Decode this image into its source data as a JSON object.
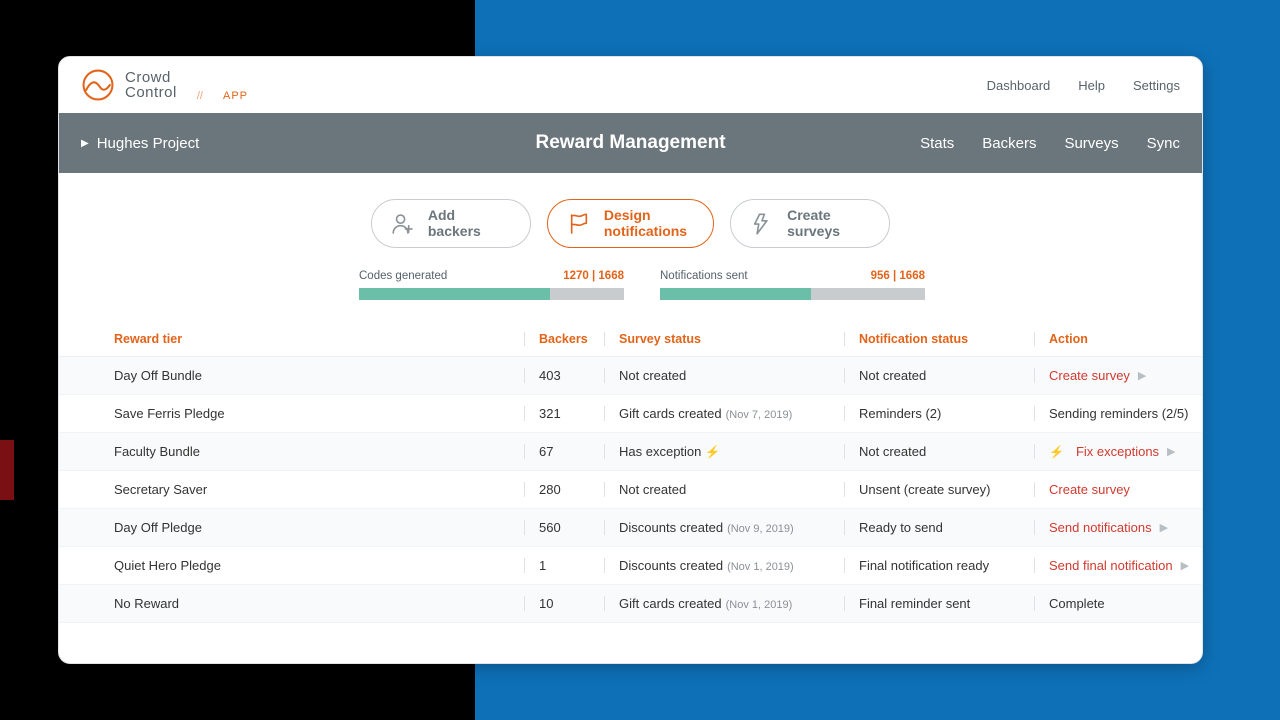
{
  "brand": {
    "line1": "Crowd",
    "line2": "Control",
    "app_tag": "APP"
  },
  "topnav": {
    "dashboard": "Dashboard",
    "help": "Help",
    "settings": "Settings"
  },
  "subbar": {
    "project": "Hughes Project",
    "title": "Reward Management",
    "links": {
      "stats": "Stats",
      "backers": "Backers",
      "surveys": "Surveys",
      "sync": "Sync"
    }
  },
  "pills": {
    "add": {
      "l1": "Add",
      "l2": "backers"
    },
    "design": {
      "l1": "Design",
      "l2": "notifications"
    },
    "create": {
      "l1": "Create",
      "l2": "surveys"
    }
  },
  "progress": {
    "codes": {
      "label": "Codes generated",
      "count": "1270 | 1668",
      "pct": 72
    },
    "notifs": {
      "label": "Notifications sent",
      "count": "956 | 1668",
      "pct": 57
    }
  },
  "columns": {
    "tier": "Reward tier",
    "backers": "Backers",
    "survey": "Survey status",
    "notif": "Notification status",
    "action": "Action"
  },
  "rows": [
    {
      "tier": "Day Off Bundle",
      "backers": "403",
      "survey": "Not created",
      "survey_date": "",
      "notif": "Not created",
      "action": "Create survey",
      "action_class": "action-red",
      "action_icon": "play"
    },
    {
      "tier": "Save Ferris Pledge",
      "backers": "321",
      "survey": "Gift cards created",
      "survey_date": "(Nov 7, 2019)",
      "notif": "Reminders (2)",
      "action": "Sending reminders (2/5)",
      "action_class": "",
      "action_icon": ""
    },
    {
      "tier": "Faculty Bundle",
      "backers": "67",
      "survey": "Has exception",
      "survey_date": "",
      "notif": "Not created",
      "action": "Fix exceptions",
      "action_class": "action-red",
      "action_icon": "play",
      "survey_bolt": true,
      "action_bolt": true
    },
    {
      "tier": "Secretary Saver",
      "backers": "280",
      "survey": "Not created",
      "survey_date": "",
      "notif": "Unsent (create survey)",
      "action": "Create survey",
      "action_class": "action-red",
      "action_icon": ""
    },
    {
      "tier": "Day Off Pledge",
      "backers": "560",
      "survey": "Discounts created",
      "survey_date": "(Nov 9, 2019)",
      "notif": "Ready to send",
      "action": "Send notifications",
      "action_class": "action-red",
      "action_icon": "play"
    },
    {
      "tier": "Quiet Hero Pledge",
      "backers": "1",
      "survey": "Discounts created",
      "survey_date": "(Nov 1, 2019)",
      "notif": "Final notification ready",
      "action": "Send final notification",
      "action_class": "action-red",
      "action_icon": "play"
    },
    {
      "tier": "No Reward",
      "backers": "10",
      "survey": "Gift cards created",
      "survey_date": "(Nov 1, 2019)",
      "notif": "Final reminder sent",
      "action": "Complete",
      "action_class": "",
      "action_icon": ""
    }
  ]
}
